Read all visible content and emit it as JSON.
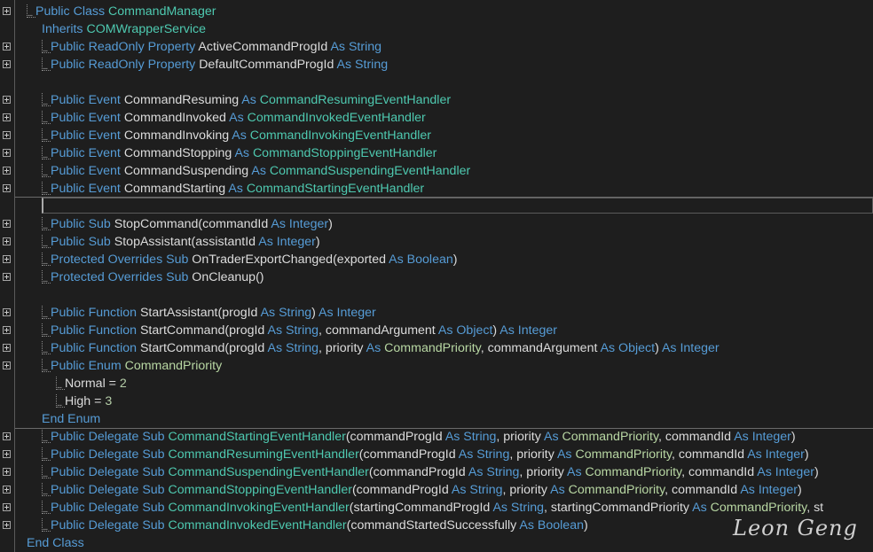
{
  "lines": [
    {
      "fold": true,
      "indent": 1,
      "dots": true,
      "tokens": [
        {
          "t": "Public Class ",
          "c": "kw"
        },
        {
          "t": "CommandManager",
          "c": "type"
        }
      ]
    },
    {
      "fold": false,
      "indent": 2,
      "dots": false,
      "tokens": [
        {
          "t": "Inherits ",
          "c": "kw"
        },
        {
          "t": "COMWrapperService",
          "c": "type"
        }
      ]
    },
    {
      "fold": true,
      "indent": 2,
      "dots": true,
      "tokens": [
        {
          "t": "Public ReadOnly Property ",
          "c": "kw"
        },
        {
          "t": "ActiveCommandProgId ",
          "c": "plain"
        },
        {
          "t": "As String",
          "c": "kw"
        }
      ]
    },
    {
      "fold": true,
      "indent": 2,
      "dots": true,
      "tokens": [
        {
          "t": "Public ReadOnly Property ",
          "c": "kw"
        },
        {
          "t": "DefaultCommandProgId ",
          "c": "plain"
        },
        {
          "t": "As String",
          "c": "kw"
        }
      ]
    },
    {
      "fold": false,
      "indent": 0,
      "dots": false,
      "tokens": []
    },
    {
      "fold": true,
      "indent": 2,
      "dots": true,
      "tokens": [
        {
          "t": "Public Event ",
          "c": "kw"
        },
        {
          "t": "CommandResuming ",
          "c": "plain"
        },
        {
          "t": "As ",
          "c": "kw"
        },
        {
          "t": "CommandResumingEventHandler",
          "c": "type"
        }
      ]
    },
    {
      "fold": true,
      "indent": 2,
      "dots": true,
      "tokens": [
        {
          "t": "Public Event ",
          "c": "kw"
        },
        {
          "t": "CommandInvoked ",
          "c": "plain"
        },
        {
          "t": "As ",
          "c": "kw"
        },
        {
          "t": "CommandInvokedEventHandler",
          "c": "type"
        }
      ]
    },
    {
      "fold": true,
      "indent": 2,
      "dots": true,
      "tokens": [
        {
          "t": "Public Event ",
          "c": "kw"
        },
        {
          "t": "CommandInvoking ",
          "c": "plain"
        },
        {
          "t": "As ",
          "c": "kw"
        },
        {
          "t": "CommandInvokingEventHandler",
          "c": "type"
        }
      ]
    },
    {
      "fold": true,
      "indent": 2,
      "dots": true,
      "tokens": [
        {
          "t": "Public Event ",
          "c": "kw"
        },
        {
          "t": "CommandStopping ",
          "c": "plain"
        },
        {
          "t": "As ",
          "c": "kw"
        },
        {
          "t": "CommandStoppingEventHandler",
          "c": "type"
        }
      ]
    },
    {
      "fold": true,
      "indent": 2,
      "dots": true,
      "tokens": [
        {
          "t": "Public Event ",
          "c": "kw"
        },
        {
          "t": "CommandSuspending ",
          "c": "plain"
        },
        {
          "t": "As ",
          "c": "kw"
        },
        {
          "t": "CommandSuspendingEventHandler",
          "c": "type"
        }
      ]
    },
    {
      "fold": true,
      "indent": 2,
      "dots": true,
      "tokens": [
        {
          "t": "Public Event ",
          "c": "kw"
        },
        {
          "t": "CommandStarting ",
          "c": "plain"
        },
        {
          "t": "As ",
          "c": "kw"
        },
        {
          "t": "CommandStartingEventHandler",
          "c": "type"
        }
      ]
    },
    {
      "fold": false,
      "indent": 0,
      "dots": false,
      "tokens": []
    },
    {
      "fold": true,
      "indent": 2,
      "dots": true,
      "tokens": [
        {
          "t": "Public Sub ",
          "c": "kw"
        },
        {
          "t": "StopCommand(commandId ",
          "c": "plain"
        },
        {
          "t": "As Integer",
          "c": "kw"
        },
        {
          "t": ")",
          "c": "plain"
        }
      ]
    },
    {
      "fold": true,
      "indent": 2,
      "dots": true,
      "tokens": [
        {
          "t": "Public Sub ",
          "c": "kw"
        },
        {
          "t": "StopAssistant(assistantId ",
          "c": "plain"
        },
        {
          "t": "As Integer",
          "c": "kw"
        },
        {
          "t": ")",
          "c": "plain"
        }
      ]
    },
    {
      "fold": true,
      "indent": 2,
      "dots": true,
      "tokens": [
        {
          "t": "Protected Overrides Sub ",
          "c": "kw"
        },
        {
          "t": "OnTraderExportChanged(exported ",
          "c": "plain"
        },
        {
          "t": "As Boolean",
          "c": "kw"
        },
        {
          "t": ")",
          "c": "plain"
        }
      ]
    },
    {
      "fold": true,
      "indent": 2,
      "dots": true,
      "tokens": [
        {
          "t": "Protected Overrides Sub ",
          "c": "kw"
        },
        {
          "t": "OnCleanup()",
          "c": "plain"
        }
      ]
    },
    {
      "fold": false,
      "indent": 0,
      "dots": false,
      "tokens": []
    },
    {
      "fold": true,
      "indent": 2,
      "dots": true,
      "tokens": [
        {
          "t": "Public Function ",
          "c": "kw"
        },
        {
          "t": "StartAssistant(progId ",
          "c": "plain"
        },
        {
          "t": "As String",
          "c": "kw"
        },
        {
          "t": ") ",
          "c": "plain"
        },
        {
          "t": "As Integer",
          "c": "kw"
        }
      ]
    },
    {
      "fold": true,
      "indent": 2,
      "dots": true,
      "tokens": [
        {
          "t": "Public Function ",
          "c": "kw"
        },
        {
          "t": "StartCommand(progId ",
          "c": "plain"
        },
        {
          "t": "As String",
          "c": "kw"
        },
        {
          "t": ", commandArgument ",
          "c": "plain"
        },
        {
          "t": "As Object",
          "c": "kw"
        },
        {
          "t": ") ",
          "c": "plain"
        },
        {
          "t": "As Integer",
          "c": "kw"
        }
      ]
    },
    {
      "fold": true,
      "indent": 2,
      "dots": true,
      "tokens": [
        {
          "t": "Public Function ",
          "c": "kw"
        },
        {
          "t": "StartCommand(progId ",
          "c": "plain"
        },
        {
          "t": "As String",
          "c": "kw"
        },
        {
          "t": ", priority ",
          "c": "plain"
        },
        {
          "t": "As ",
          "c": "kw"
        },
        {
          "t": "CommandPriority",
          "c": "enum"
        },
        {
          "t": ", commandArgument ",
          "c": "plain"
        },
        {
          "t": "As Object",
          "c": "kw"
        },
        {
          "t": ") ",
          "c": "plain"
        },
        {
          "t": "As Integer",
          "c": "kw"
        }
      ]
    },
    {
      "fold": true,
      "indent": 2,
      "dots": true,
      "tokens": [
        {
          "t": "Public Enum ",
          "c": "kw"
        },
        {
          "t": "CommandPriority",
          "c": "enum"
        }
      ]
    },
    {
      "fold": false,
      "indent": 3,
      "dots": true,
      "tokens": [
        {
          "t": "Normal = ",
          "c": "plain"
        },
        {
          "t": "2",
          "c": "num"
        }
      ]
    },
    {
      "fold": false,
      "indent": 3,
      "dots": true,
      "tokens": [
        {
          "t": "High = ",
          "c": "plain"
        },
        {
          "t": "3",
          "c": "num"
        }
      ]
    },
    {
      "fold": false,
      "indent": 2,
      "dots": false,
      "tokens": [
        {
          "t": "End Enum",
          "c": "kw"
        }
      ]
    },
    {
      "fold": true,
      "indent": 2,
      "dots": true,
      "tokens": [
        {
          "t": "Public Delegate Sub ",
          "c": "kw"
        },
        {
          "t": "CommandStartingEventHandler",
          "c": "type"
        },
        {
          "t": "(commandProgId ",
          "c": "plain"
        },
        {
          "t": "As String",
          "c": "kw"
        },
        {
          "t": ", priority ",
          "c": "plain"
        },
        {
          "t": "As ",
          "c": "kw"
        },
        {
          "t": "CommandPriority",
          "c": "enum"
        },
        {
          "t": ", commandId ",
          "c": "plain"
        },
        {
          "t": "As Integer",
          "c": "kw"
        },
        {
          "t": ")",
          "c": "plain"
        }
      ]
    },
    {
      "fold": true,
      "indent": 2,
      "dots": true,
      "tokens": [
        {
          "t": "Public Delegate Sub ",
          "c": "kw"
        },
        {
          "t": "CommandResumingEventHandler",
          "c": "type"
        },
        {
          "t": "(commandProgId ",
          "c": "plain"
        },
        {
          "t": "As String",
          "c": "kw"
        },
        {
          "t": ", priority ",
          "c": "plain"
        },
        {
          "t": "As ",
          "c": "kw"
        },
        {
          "t": "CommandPriority",
          "c": "enum"
        },
        {
          "t": ", commandId ",
          "c": "plain"
        },
        {
          "t": "As Integer",
          "c": "kw"
        },
        {
          "t": ")",
          "c": "plain"
        }
      ]
    },
    {
      "fold": true,
      "indent": 2,
      "dots": true,
      "tokens": [
        {
          "t": "Public Delegate Sub ",
          "c": "kw"
        },
        {
          "t": "CommandSuspendingEventHandler",
          "c": "type"
        },
        {
          "t": "(commandProgId ",
          "c": "plain"
        },
        {
          "t": "As String",
          "c": "kw"
        },
        {
          "t": ", priority ",
          "c": "plain"
        },
        {
          "t": "As ",
          "c": "kw"
        },
        {
          "t": "CommandPriority",
          "c": "enum"
        },
        {
          "t": ", commandId ",
          "c": "plain"
        },
        {
          "t": "As Integer",
          "c": "kw"
        },
        {
          "t": ")",
          "c": "plain"
        }
      ]
    },
    {
      "fold": true,
      "indent": 2,
      "dots": true,
      "tokens": [
        {
          "t": "Public Delegate Sub ",
          "c": "kw"
        },
        {
          "t": "CommandStoppingEventHandler",
          "c": "type"
        },
        {
          "t": "(commandProgId ",
          "c": "plain"
        },
        {
          "t": "As String",
          "c": "kw"
        },
        {
          "t": ", priority ",
          "c": "plain"
        },
        {
          "t": "As ",
          "c": "kw"
        },
        {
          "t": "CommandPriority",
          "c": "enum"
        },
        {
          "t": ", commandId ",
          "c": "plain"
        },
        {
          "t": "As Integer",
          "c": "kw"
        },
        {
          "t": ")",
          "c": "plain"
        }
      ]
    },
    {
      "fold": true,
      "indent": 2,
      "dots": true,
      "tokens": [
        {
          "t": "Public Delegate Sub ",
          "c": "kw"
        },
        {
          "t": "CommandInvokingEventHandler",
          "c": "type"
        },
        {
          "t": "(startingCommandProgId ",
          "c": "plain"
        },
        {
          "t": "As String",
          "c": "kw"
        },
        {
          "t": ", startingCommandPriority ",
          "c": "plain"
        },
        {
          "t": "As ",
          "c": "kw"
        },
        {
          "t": "CommandPriority",
          "c": "enum"
        },
        {
          "t": ", st",
          "c": "plain"
        }
      ]
    },
    {
      "fold": true,
      "indent": 2,
      "dots": true,
      "tokens": [
        {
          "t": "Public Delegate Sub ",
          "c": "kw"
        },
        {
          "t": "CommandInvokedEventHandler",
          "c": "type"
        },
        {
          "t": "(commandStartedSuccessfully ",
          "c": "plain"
        },
        {
          "t": "As Boolean",
          "c": "kw"
        },
        {
          "t": ")",
          "c": "plain"
        }
      ]
    },
    {
      "fold": false,
      "indent": 1,
      "dots": false,
      "tokens": [
        {
          "t": "End Class",
          "c": "kw"
        }
      ]
    }
  ],
  "watermark": "Leon Geng",
  "colors": {
    "background": "#1e1e1e",
    "keyword": "#569cd6",
    "type": "#4ec9b0",
    "enum": "#b8d7a3",
    "number": "#b5cea8",
    "identifier": "#dcdcdc"
  }
}
